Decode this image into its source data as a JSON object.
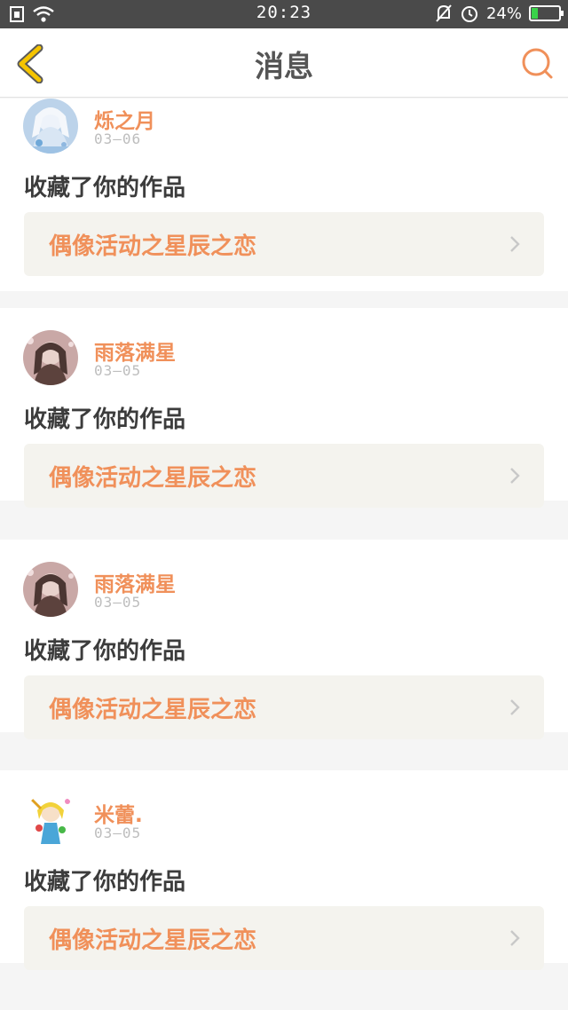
{
  "status_bar": {
    "time": "20:23",
    "battery": "24%",
    "battery_level": 0.24,
    "icons": [
      "sim-icon",
      "wifi-icon",
      "mute-icon",
      "alarm-icon",
      "battery-icon"
    ]
  },
  "header": {
    "title": "消息",
    "back_icon": "back-chevron-icon",
    "search_icon": "search-icon"
  },
  "colors": {
    "accent": "#f0905a",
    "back_icon": "#f5c400"
  },
  "messages": [
    {
      "username": "烁之月",
      "date": "03—06",
      "action": "收藏了你的作品",
      "work_title": "偶像活动之星辰之恋"
    },
    {
      "username": "雨落满星",
      "date": "03—05",
      "action": "收藏了你的作品",
      "work_title": "偶像活动之星辰之恋"
    },
    {
      "username": "雨落满星",
      "date": "03—05",
      "action": "收藏了你的作品",
      "work_title": "偶像活动之星辰之恋"
    },
    {
      "username": "米蕾.",
      "date": "03—05",
      "action": "收藏了你的作品",
      "work_title": "偶像活动之星辰之恋"
    }
  ]
}
